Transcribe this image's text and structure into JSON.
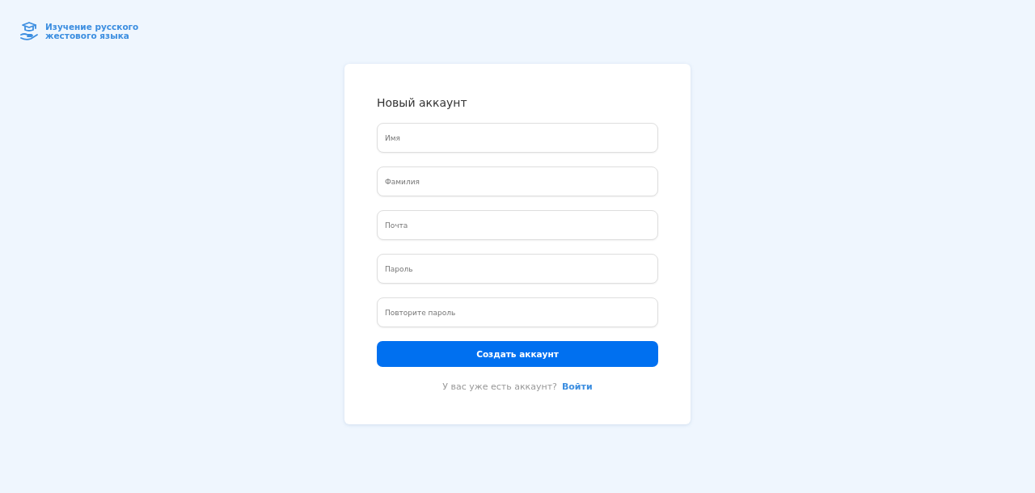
{
  "logo": {
    "title_line1": "Изучение русского",
    "title_line2": "жестового языка"
  },
  "form": {
    "title": "Новый аккаунт",
    "fields": [
      {
        "placeholder": "Имя"
      },
      {
        "placeholder": "Фамилия"
      },
      {
        "placeholder": "Почта"
      },
      {
        "placeholder": "Пароль"
      },
      {
        "placeholder": "Повторите пароль"
      }
    ],
    "submit": "Создать аккаунт",
    "prompt": "У вас уже есть аккаунт?",
    "login_link": "Войти"
  }
}
